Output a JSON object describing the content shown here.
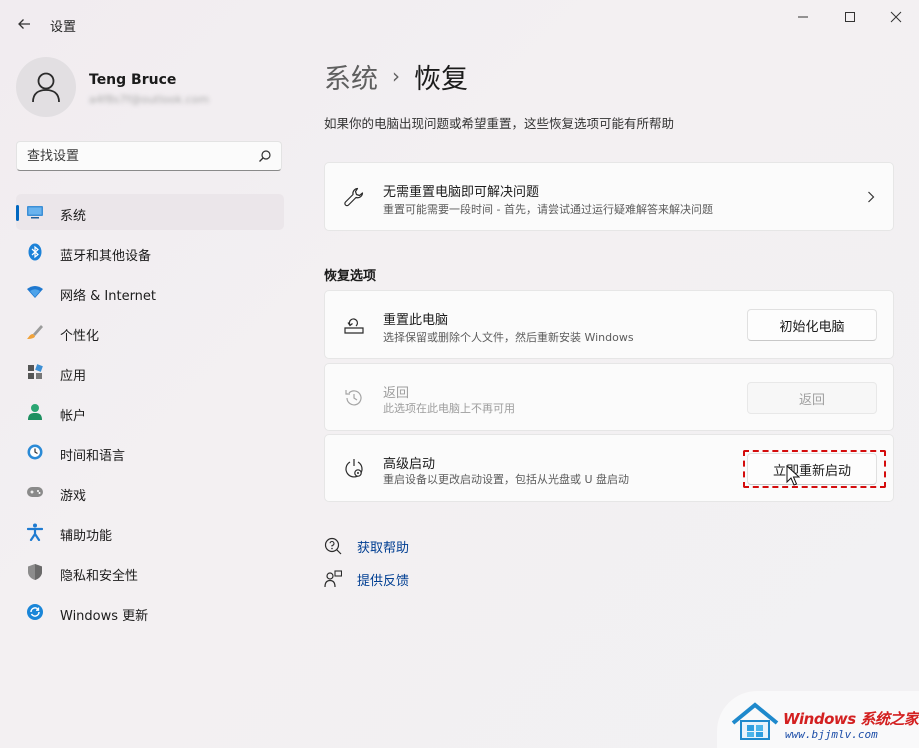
{
  "window": {
    "title": "设置",
    "controls": {
      "minimize": "minimize",
      "maximize": "maximize",
      "close": "close"
    }
  },
  "profile": {
    "name": "Teng Bruce",
    "email": "a4f8s7f@outlook.com"
  },
  "search": {
    "placeholder": "查找设置"
  },
  "sidebar": {
    "items": [
      {
        "label": "系统",
        "icon": "system-monitor-icon",
        "selected": true
      },
      {
        "label": "蓝牙和其他设备",
        "icon": "bluetooth-icon"
      },
      {
        "label": "网络 & Internet",
        "icon": "wifi-icon"
      },
      {
        "label": "个性化",
        "icon": "brush-icon"
      },
      {
        "label": "应用",
        "icon": "apps-icon"
      },
      {
        "label": "帐户",
        "icon": "account-icon"
      },
      {
        "label": "时间和语言",
        "icon": "time-language-icon"
      },
      {
        "label": "游戏",
        "icon": "gamepad-icon"
      },
      {
        "label": "辅助功能",
        "icon": "accessibility-icon"
      },
      {
        "label": "隐私和安全性",
        "icon": "shield-icon"
      },
      {
        "label": "Windows 更新",
        "icon": "windows-update-icon"
      }
    ]
  },
  "main": {
    "breadcrumb": {
      "parent": "系统",
      "separator": "›",
      "current": "恢复"
    },
    "description": "如果你的电脑出现问题或希望重置，这些恢复选项可能有所帮助",
    "troubleshoot_card": {
      "title": "无需重置电脑即可解决问题",
      "subtitle": "重置可能需要一段时间 - 首先，请尝试通过运行疑难解答来解决问题"
    },
    "recovery_section_title": "恢复选项",
    "recovery_options": [
      {
        "title": "重置此电脑",
        "subtitle": "选择保留或删除个人文件，然后重新安装 Windows",
        "button": "初始化电脑",
        "enabled": true
      },
      {
        "title": "返回",
        "subtitle": "此选项在此电脑上不再可用",
        "button": "返回",
        "enabled": false
      },
      {
        "title": "高级启动",
        "subtitle": "重启设备以更改启动设置，包括从光盘或 U 盘启动",
        "button": "立即重新启动",
        "enabled": true
      }
    ],
    "links": [
      {
        "label": "获取帮助",
        "icon": "help-icon"
      },
      {
        "label": "提供反馈",
        "icon": "feedback-icon"
      }
    ]
  },
  "watermark": {
    "line1": "Windows 系统之家",
    "line2": "www.bjjmlv.com"
  },
  "colors": {
    "accent": "#0067c0",
    "highlight": "#d40c0c",
    "link": "#003e92"
  }
}
